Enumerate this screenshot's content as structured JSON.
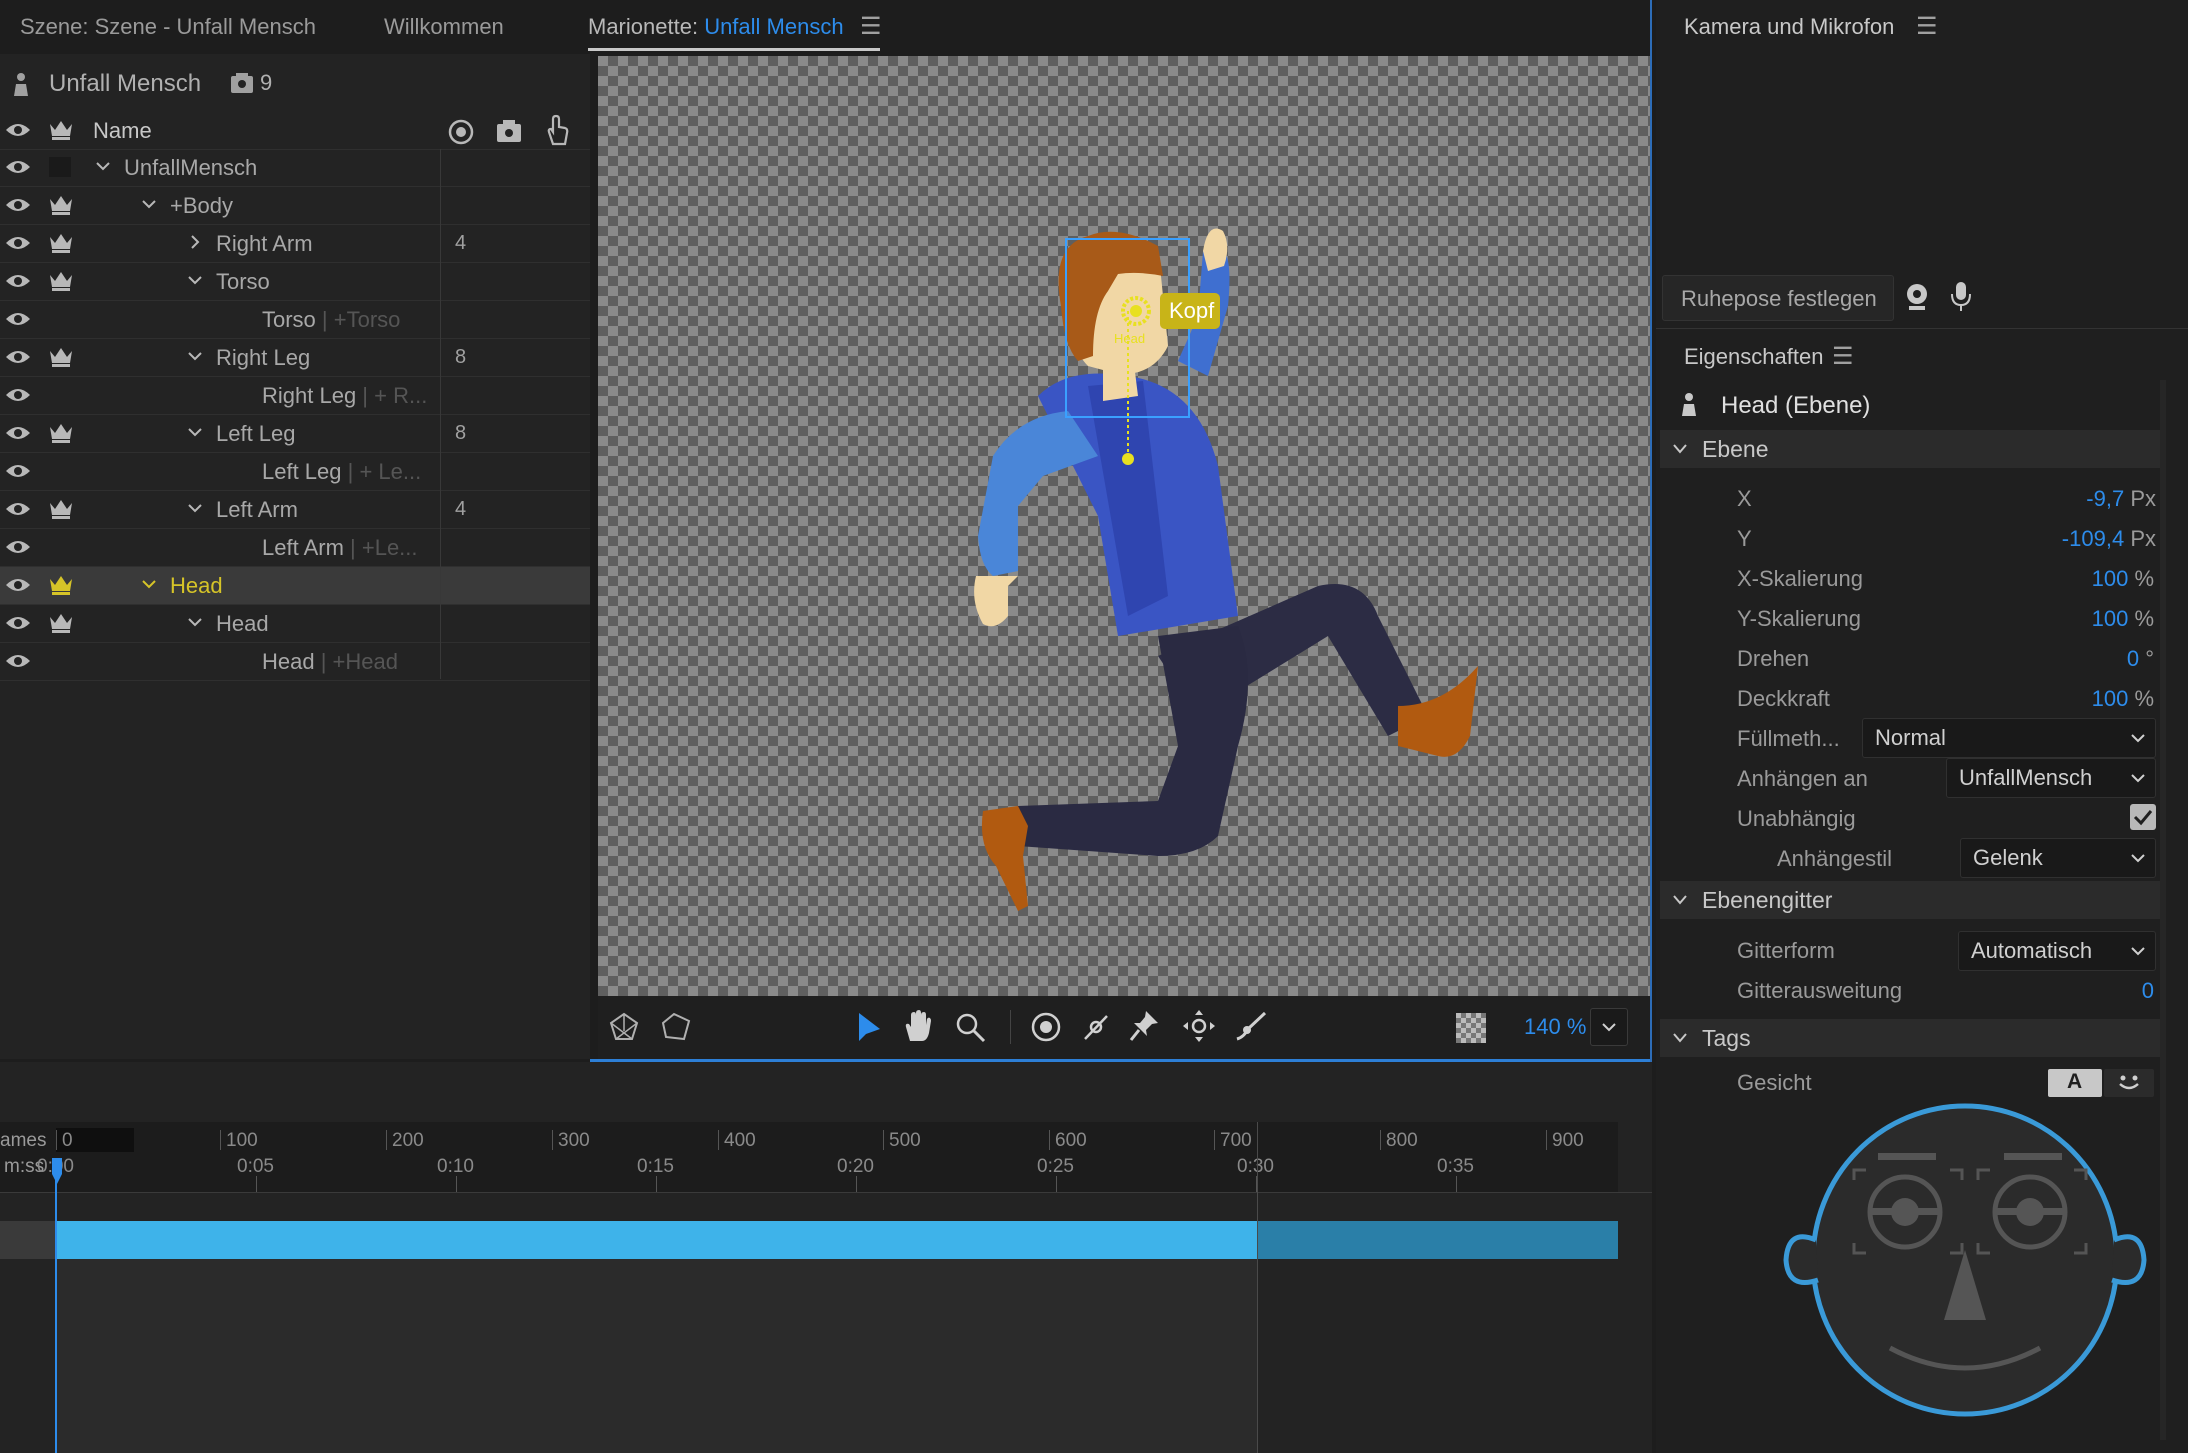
{
  "tabs": {
    "scene": "Szene: Szene - Unfall Mensch",
    "welcome": "Willkommen",
    "puppet_prefix": "Marionette:",
    "puppet_name": "Unfall Mensch",
    "camera": "Kamera und Mikrofon"
  },
  "puppet": {
    "name": "Unfall Mensch",
    "count": "9"
  },
  "layers": {
    "header_name": "Name",
    "rows": [
      {
        "label": "UnfallMensch",
        "sub": "",
        "num": ""
      },
      {
        "label": "+Body",
        "sub": "",
        "num": ""
      },
      {
        "label": "Right Arm",
        "sub": "",
        "num": "4"
      },
      {
        "label": "Torso",
        "sub": "",
        "num": ""
      },
      {
        "label": "Torso",
        "sub": " | +Torso",
        "num": ""
      },
      {
        "label": "Right Leg",
        "sub": "",
        "num": "8"
      },
      {
        "label": "Right Leg",
        "sub": " | + R...",
        "num": ""
      },
      {
        "label": "Left Leg",
        "sub": "",
        "num": "8"
      },
      {
        "label": "Left Leg",
        "sub": " | + Le...",
        "num": ""
      },
      {
        "label": "Left Arm",
        "sub": "",
        "num": "4"
      },
      {
        "label": "Left Arm",
        "sub": " | +Le...",
        "num": ""
      },
      {
        "label": "Head",
        "sub": "",
        "num": ""
      },
      {
        "label": "Head",
        "sub": "",
        "num": ""
      },
      {
        "label": "Head",
        "sub": " | +Head",
        "num": ""
      }
    ]
  },
  "canvas": {
    "handle_tag": "Kopf",
    "handle_label": "Head",
    "zoom": "140 %"
  },
  "camera_panel": {
    "rest_pose_button": "Ruhepose festlegen"
  },
  "properties": {
    "title": "Eigenschaften",
    "selection": "Head (Ebene)",
    "section_layer": "Ebene",
    "x_label": "X",
    "x_value": "-9,7",
    "x_unit": "Px",
    "y_label": "Y",
    "y_value": "-109,4",
    "y_unit": "Px",
    "xscale_label": "X-Skalierung",
    "xscale_value": "100",
    "xscale_unit": "%",
    "yscale_label": "Y-Skalierung",
    "yscale_value": "100",
    "yscale_unit": "%",
    "rotate_label": "Drehen",
    "rotate_value": "0",
    "rotate_unit": "°",
    "opacity_label": "Deckkraft",
    "opacity_value": "100",
    "opacity_unit": "%",
    "blend_label": "Füllmeth...",
    "blend_value": "Normal",
    "attach_label": "Anhängen an",
    "attach_value": "UnfallMensch",
    "independent_label": "Unabhängig",
    "independent_checked": true,
    "attach_style_label": "Anhängestil",
    "attach_style_value": "Gelenk",
    "section_mesh": "Ebenengitter",
    "mesh_shape_label": "Gitterform",
    "mesh_shape_value": "Automatisch",
    "mesh_expand_label": "Gitterausweitung",
    "mesh_expand_value": "0",
    "section_tags": "Tags",
    "face_label": "Gesicht",
    "tag_btn_a": "A"
  },
  "timeline": {
    "frames_label": "ames",
    "time_label": "m:ss",
    "frame_ticks": [
      "0",
      "100",
      "200",
      "300",
      "400",
      "500",
      "600",
      "700",
      "800",
      "900"
    ],
    "time_ticks": [
      "0:00",
      "0:05",
      "0:10",
      "0:15",
      "0:20",
      "0:25",
      "0:30",
      "0:35"
    ]
  },
  "colors": {
    "accent": "#2d8ceb",
    "selection_yellow": "#d6c428",
    "bar": "#3eb3ea",
    "bar_dim": "#2a7fa8"
  }
}
